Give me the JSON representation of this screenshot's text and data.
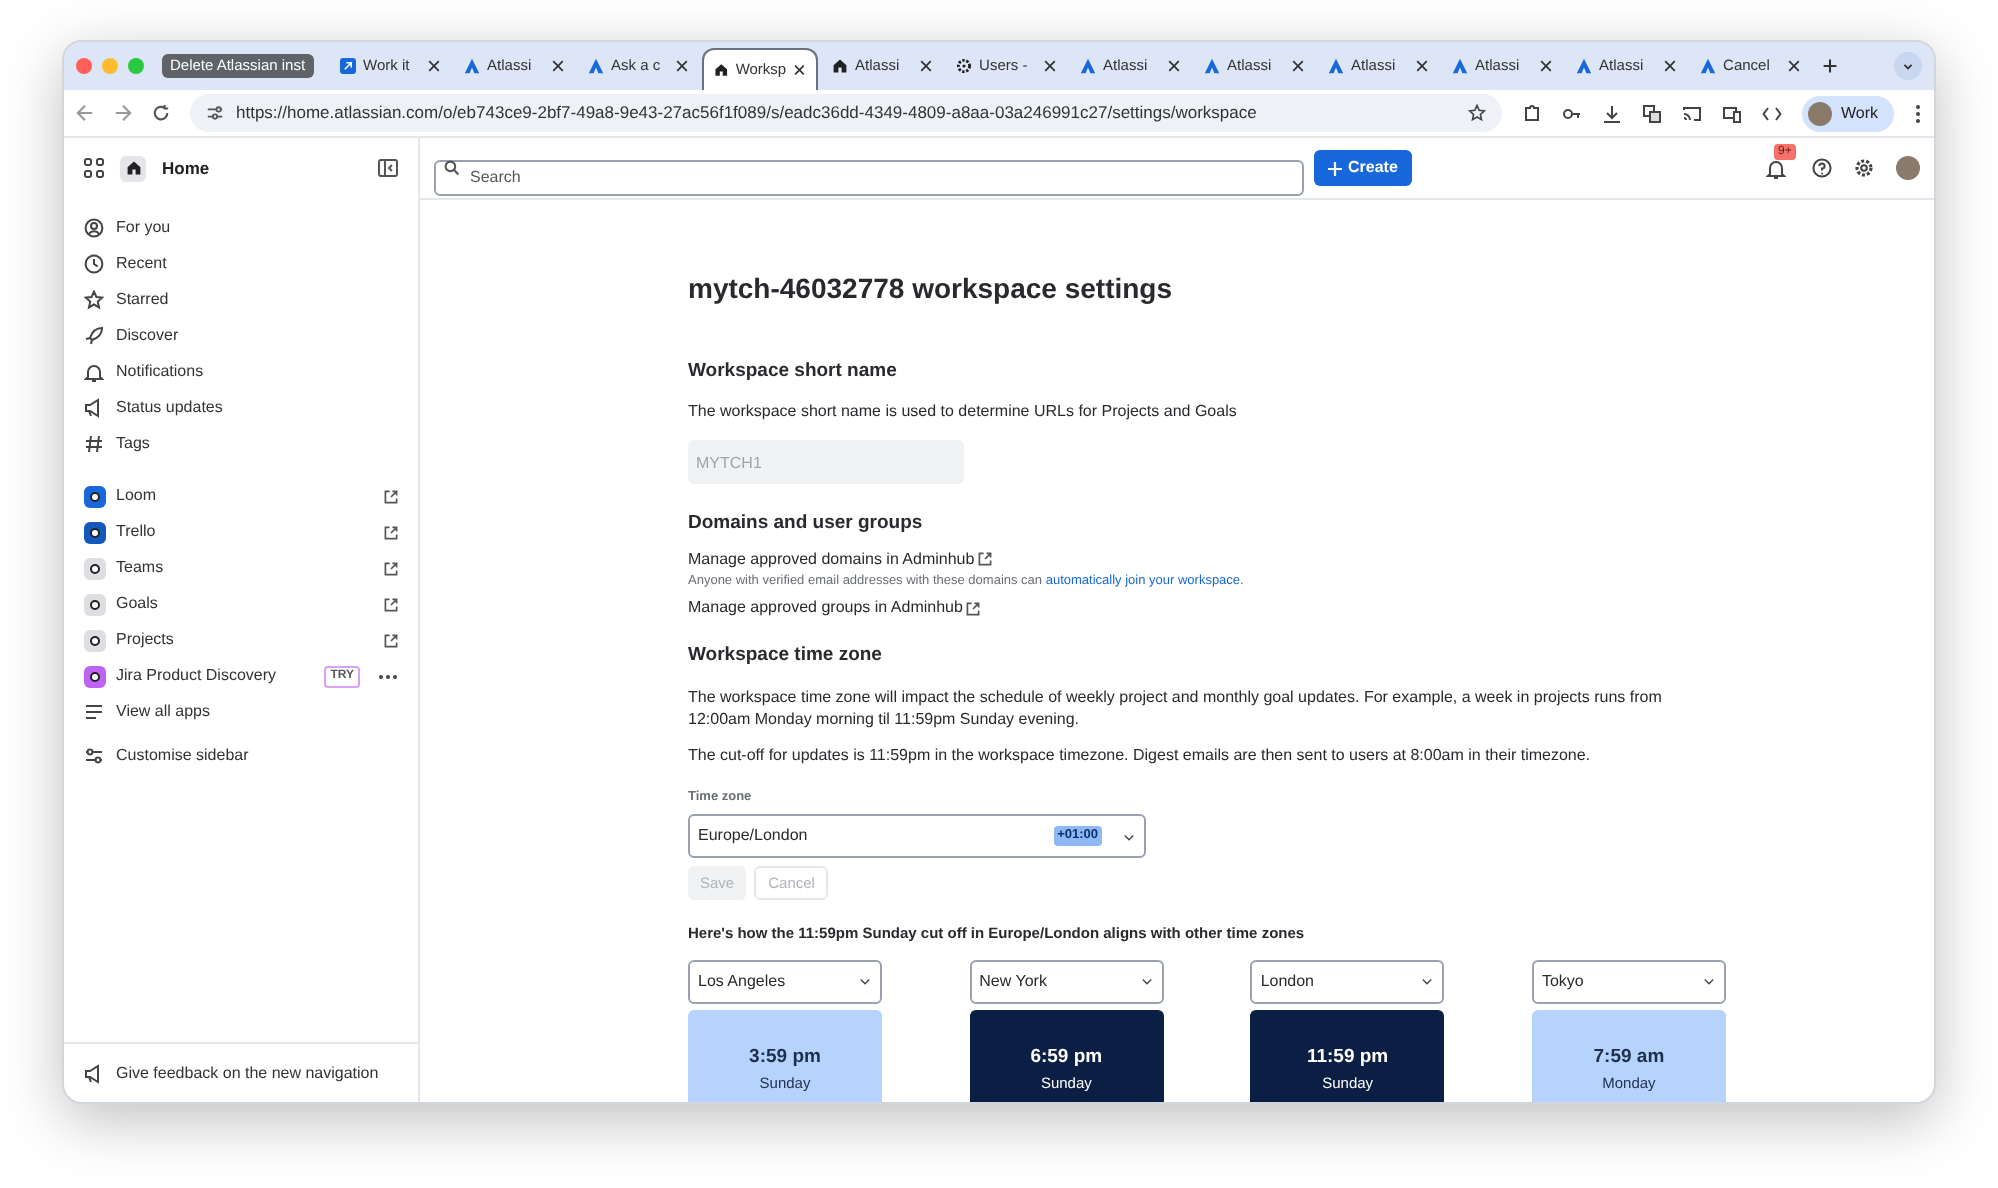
{
  "browser": {
    "tab_group": "Delete Atlassian inst",
    "tabs": [
      {
        "label": "Work it",
        "kind": "jira",
        "selected": false
      },
      {
        "label": "Atlassi",
        "kind": "atlassian",
        "selected": false
      },
      {
        "label": "Ask a c",
        "kind": "atlassian",
        "selected": false
      },
      {
        "label": "Worksp",
        "kind": "home",
        "selected": true
      },
      {
        "label": "Atlassi",
        "kind": "home",
        "selected": false
      },
      {
        "label": "Users -",
        "kind": "gear",
        "selected": false
      },
      {
        "label": "Atlassi",
        "kind": "atlassian",
        "selected": false
      },
      {
        "label": "Atlassi",
        "kind": "atlassian",
        "selected": false
      },
      {
        "label": "Atlassi",
        "kind": "atlassian",
        "selected": false
      },
      {
        "label": "Atlassi",
        "kind": "atlassian",
        "selected": false
      },
      {
        "label": "Atlassi",
        "kind": "atlassian",
        "selected": false
      },
      {
        "label": "Cancel",
        "kind": "atlassian",
        "selected": false
      }
    ],
    "url": "https://home.atlassian.com/o/eb743ce9-2bf7-49a8-9e43-27ac56f1f089/s/eadc36dd-4349-4809-a8aa-03a246991c27/settings/workspace",
    "profile": "Work"
  },
  "sidebar": {
    "home": "Home",
    "nav": [
      {
        "label": "For you",
        "kind": "person"
      },
      {
        "label": "Recent",
        "kind": "clock"
      },
      {
        "label": "Starred",
        "kind": "star"
      },
      {
        "label": "Discover",
        "kind": "rocket"
      },
      {
        "label": "Notifications",
        "kind": "bell"
      },
      {
        "label": "Status updates",
        "kind": "megaphone"
      },
      {
        "label": "Tags",
        "kind": "hash"
      }
    ],
    "apps": [
      {
        "label": "Loom",
        "color": "#1868db",
        "external": true
      },
      {
        "label": "Trello",
        "color": "#1558bc",
        "external": true
      },
      {
        "label": "Teams",
        "color": "#dddee1",
        "external": true
      },
      {
        "label": "Goals",
        "color": "#dddee1",
        "external": true
      },
      {
        "label": "Projects",
        "color": "#dddee1",
        "external": true
      },
      {
        "label": "Jira Product Discovery",
        "color": "#bf63f3",
        "external": false,
        "badge": "TRY"
      }
    ],
    "view_all": "View all apps",
    "customise": "Customise sidebar",
    "feedback": "Give feedback on the new navigation"
  },
  "topbar": {
    "search_placeholder": "Search",
    "create": "Create",
    "notification_count": "9+"
  },
  "page": {
    "title": "mytch-46032778 workspace settings",
    "short_name": {
      "heading": "Workspace short name",
      "description": "The workspace short name is used to determine URLs for Projects and Goals",
      "value": "MYTCH1"
    },
    "domains": {
      "heading": "Domains and user groups",
      "domains_link": "Manage approved domains in Adminhub",
      "note": "Anyone with verified email addresses with these domains can",
      "note_link": "automatically join your workspace",
      "note_end": ".",
      "groups_link": "Manage approved groups in Adminhub"
    },
    "time_zone": {
      "heading": "Workspace time zone",
      "paragraphs": [
        "The workspace time zone will impact the schedule of weekly project and monthly goal updates. For example, a week in projects runs from 12:00am Monday morning til 11:59pm Sunday evening.",
        "The cut-off for updates is 11:59pm in the workspace timezone. Digest emails are then sent to users at 8:00am in their timezone."
      ],
      "field_label": "Time zone",
      "value": "Europe/London",
      "offset": "+01:00",
      "save": "Save",
      "cancel": "Cancel",
      "buttons_disabled": true
    },
    "comparison": {
      "heading": "Here's how the 11:59pm Sunday cut off in Europe/London aligns with other time zones",
      "zones": [
        {
          "city": "Los Angeles",
          "time": "3:59 pm",
          "day": "Sunday",
          "night": false
        },
        {
          "city": "New York",
          "time": "6:59 pm",
          "day": "Sunday",
          "night": true
        },
        {
          "city": "London",
          "time": "11:59 pm",
          "day": "Sunday",
          "night": true
        },
        {
          "city": "Tokyo",
          "time": "7:59 am",
          "day": "Monday",
          "night": false
        }
      ]
    }
  }
}
